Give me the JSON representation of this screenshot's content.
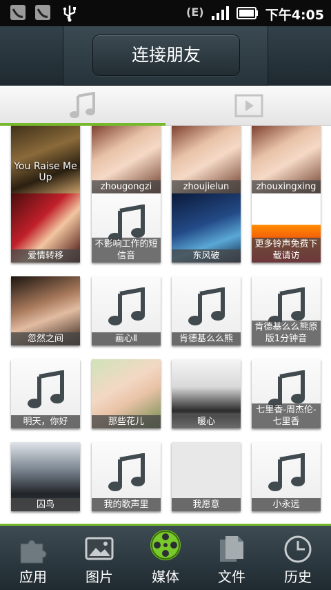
{
  "status_bar": {
    "network": "E",
    "time": "下午4:05"
  },
  "header": {
    "connect_label": "连接朋友"
  },
  "tabs": [
    {
      "name": "music",
      "icon": "music-note-icon",
      "selected": true
    },
    {
      "name": "video",
      "icon": "play-icon",
      "selected": false
    }
  ],
  "items": [
    {
      "label": "You Raise Me Up",
      "art": "photo"
    },
    {
      "label": "zhougongzi",
      "art": "photo"
    },
    {
      "label": "zhoujielun",
      "art": "photo"
    },
    {
      "label": "zhouxingxing",
      "art": "photo"
    },
    {
      "label": "爱情转移",
      "art": "photo"
    },
    {
      "label": "不影响工作的短信音",
      "art": "note"
    },
    {
      "label": "东风破",
      "art": "photo"
    },
    {
      "label": "更多铃声免费下载请访",
      "art": "photo"
    },
    {
      "label": "忽然之间",
      "art": "photo"
    },
    {
      "label": "画心Ⅱ",
      "art": "note"
    },
    {
      "label": "肯德基么么熊",
      "art": "note"
    },
    {
      "label": "肯德基么么熊原版1分钟音",
      "art": "note"
    },
    {
      "label": "明天，你好",
      "art": "note"
    },
    {
      "label": "那些花儿",
      "art": "photo"
    },
    {
      "label": "暖心",
      "art": "photo"
    },
    {
      "label": "七里香-周杰伦-七里香",
      "art": "note"
    },
    {
      "label": "囚鸟",
      "art": "photo"
    },
    {
      "label": "我的歌声里",
      "art": "note"
    },
    {
      "label": "我愿意",
      "art": "blank"
    },
    {
      "label": "小永远",
      "art": "note"
    }
  ],
  "bottom_nav": [
    {
      "label": "应用",
      "icon": "puzzle-icon"
    },
    {
      "label": "图片",
      "icon": "picture-icon"
    },
    {
      "label": "媒体",
      "icon": "film-reel-icon",
      "selected": true
    },
    {
      "label": "文件",
      "icon": "files-icon"
    },
    {
      "label": "历史",
      "icon": "clock-icon"
    }
  ],
  "colors": {
    "accent": "#77b92c",
    "header": "#2c3a41",
    "status_bar": "#0b0b0b"
  }
}
